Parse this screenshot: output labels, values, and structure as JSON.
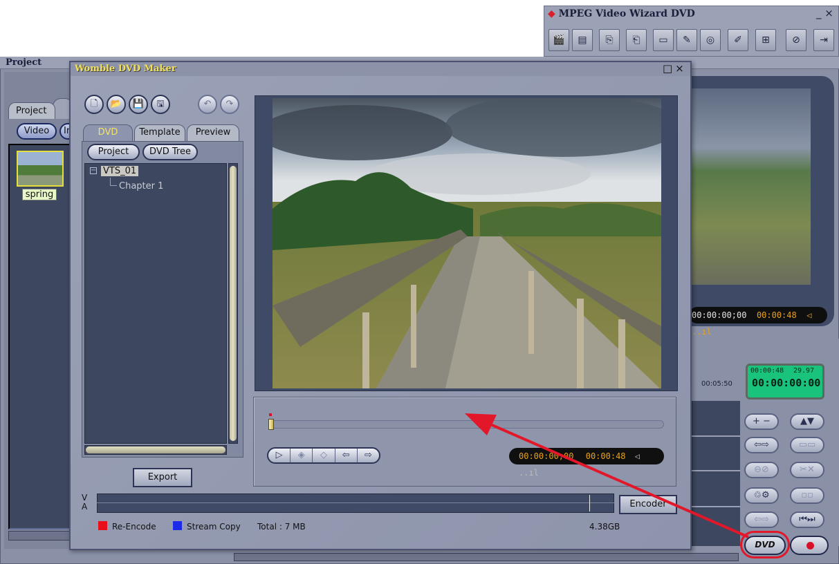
{
  "wizard": {
    "title": "MPEG Video Wizard DVD",
    "controls": "_ ×",
    "toolbar_icons": [
      "clapper-icon",
      "ruler-icon",
      "import-icon",
      "export-icon",
      "caption-icon",
      "edit-icon",
      "dvd-icon",
      "paint-icon",
      "layout-icon",
      "disc-icon",
      "exit-icon"
    ]
  },
  "project_panel": {
    "title": "Project",
    "tab_label": "Project",
    "video_pill": "Video",
    "second_pill": "Ir",
    "thumb_label": "spring"
  },
  "dialog": {
    "title": "Womble DVD Maker",
    "controls": "□×",
    "tabs": [
      "DVD",
      "Template",
      "Preview"
    ],
    "sub_buttons": [
      "Project",
      "DVD Tree"
    ],
    "tree": {
      "root": "VTS_01",
      "child": "Chapter 1"
    },
    "export_label": "Export",
    "encoder_label": "Encoder",
    "va_label_v": "V",
    "va_label_a": "A",
    "legend": {
      "reencode": "Re-Encode",
      "streamcopy": "Stream Copy",
      "total": "Total : 7 MB",
      "capacity": "4.38GB"
    },
    "player": {
      "time_current": "00:00:00;00",
      "time_total": "00:00:48",
      "volume_glyph": "◁ ..ıl"
    }
  },
  "right_panel": {
    "time_current": "00:00:00;00",
    "time_total": "00:00:48",
    "volume_glyph": "◁ ..ıl",
    "lcd_dur": "00:00:48",
    "lcd_fps": "29.97",
    "lcd_time": "00:00:00:00",
    "timeline_tick": "00:05:50",
    "dvd_label": "DVD"
  },
  "colors": {
    "arrow": "#e2172a",
    "reencode": "#e8101a",
    "streamcopy": "#1a2ae8",
    "title_yellow": "#f1e05a",
    "lcd_green": "#19c37b"
  }
}
